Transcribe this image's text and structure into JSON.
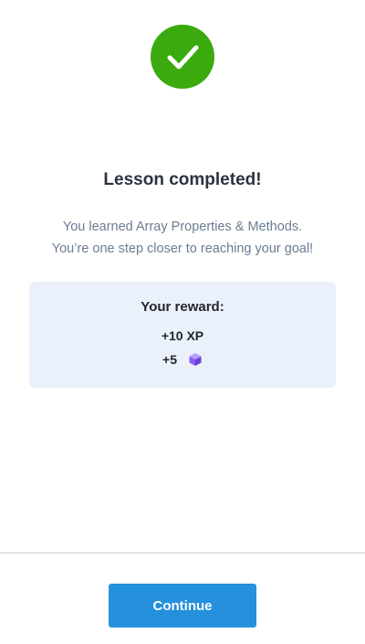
{
  "colors": {
    "success_green": "#3aaa0e",
    "title_text": "#2a3240",
    "muted_text": "#6b7c92",
    "card_background": "#ebf1fb",
    "primary_button": "#2590dc",
    "divider": "#c5d0d8",
    "gem_purple": "#8b5cf6"
  },
  "header": {
    "icon": "checkmark-icon"
  },
  "lesson": {
    "title": "Lesson completed!",
    "message_line1": "You learned Array Properties & Methods.",
    "message_line2": "You’re one step closer to reaching your goal!"
  },
  "reward": {
    "heading": "Your reward:",
    "xp": "+10 XP",
    "gems": "+5",
    "gem_icon": "gem-icon"
  },
  "footer": {
    "continue_label": "Continue"
  }
}
